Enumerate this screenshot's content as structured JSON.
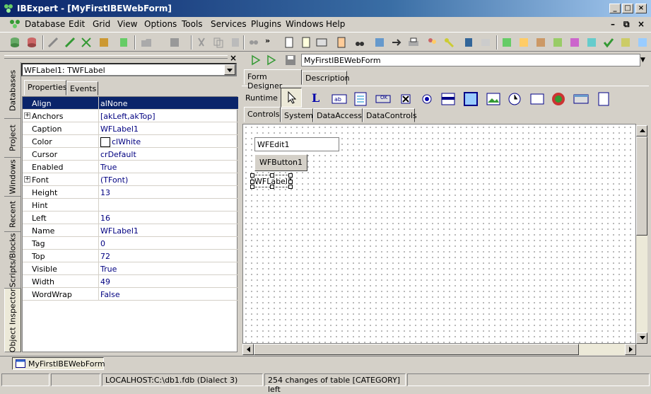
{
  "window": {
    "title": "IBExpert - [MyFirstIBEWebForm]"
  },
  "menu": [
    "Database",
    "Edit",
    "Grid",
    "View",
    "Options",
    "Tools",
    "Services",
    "Plugins",
    "Windows",
    "Help"
  ],
  "left_tabs": [
    "Databases",
    "Project",
    "Windows",
    "Recent",
    "Scripts/Blocks",
    "Object Inspector"
  ],
  "inspector": {
    "component": "WFLabel1: TWFLabel",
    "tabs": [
      "Properties",
      "Events"
    ],
    "properties": [
      {
        "name": "Align",
        "value": "alNone",
        "selected": true
      },
      {
        "name": "Anchors",
        "value": "[akLeft,akTop]",
        "expand": true
      },
      {
        "name": "Caption",
        "value": "WFLabel1"
      },
      {
        "name": "Color",
        "value": "clWhite",
        "swatch": true
      },
      {
        "name": "Cursor",
        "value": "crDefault"
      },
      {
        "name": "Enabled",
        "value": "True"
      },
      {
        "name": "Font",
        "value": "(TFont)",
        "expand": true
      },
      {
        "name": "Height",
        "value": "13"
      },
      {
        "name": "Hint",
        "value": ""
      },
      {
        "name": "Left",
        "value": "16"
      },
      {
        "name": "Name",
        "value": "WFLabel1"
      },
      {
        "name": "Tag",
        "value": "0"
      },
      {
        "name": "Top",
        "value": "72"
      },
      {
        "name": "Visible",
        "value": "True"
      },
      {
        "name": "Width",
        "value": "49"
      },
      {
        "name": "WordWrap",
        "value": "False"
      }
    ]
  },
  "designer": {
    "form_name": "MyFirstIBEWebForm",
    "tabs": [
      "Form Designer",
      "Description"
    ],
    "runtime_label": "Runtime",
    "palette_tabs": [
      "Controls",
      "System",
      "DataAccess",
      "DataControls"
    ],
    "palette_label_glyph": "L",
    "palette_ok_glyph": "OK",
    "canvas": {
      "edit": "WFEdit1",
      "button": "WFButton1",
      "label": "WFLabel1"
    }
  },
  "taskbar": {
    "item": "MyFirstIBEWebForm"
  },
  "status": {
    "connection": "LOCALHOST:C:\\db1.fdb (Dialect 3)",
    "message": "254 changes of table [CATEGORY] left"
  }
}
